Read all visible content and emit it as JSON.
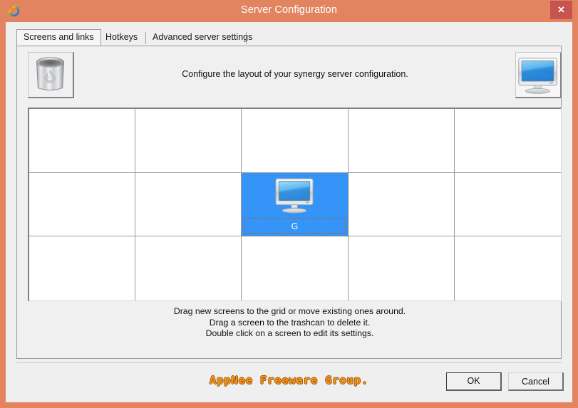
{
  "window": {
    "title": "Server Configuration",
    "app_icon": "synergy-ring-icon",
    "close_label": "✕",
    "border_color": "#e28460",
    "close_bg": "#c9534e"
  },
  "tabs": [
    {
      "label": "Screens and links",
      "selected": true
    },
    {
      "label": "Hotkeys",
      "selected": false
    },
    {
      "label": "Advanced server settings",
      "selected": false
    }
  ],
  "page": {
    "description": "Configure the layout of your synergy server configuration.",
    "trash_icon": "trashcan-icon",
    "new_screen_icon": "monitor-icon"
  },
  "grid": {
    "columns": 5,
    "rows": 3,
    "screens": [
      {
        "row": 1,
        "col": 2,
        "label": "G",
        "icon": "monitor-icon",
        "selected": true
      }
    ],
    "selected_color": "#3494f7"
  },
  "hints": [
    "Drag new screens to the grid or move existing ones around.",
    "Drag a screen to the trashcan to delete it.",
    "Double click on a screen to edit its settings."
  ],
  "watermark": {
    "text": "AppNee Freeware Group.",
    "color": "#f2941f"
  },
  "buttons": {
    "ok": "OK",
    "cancel": "Cancel"
  }
}
